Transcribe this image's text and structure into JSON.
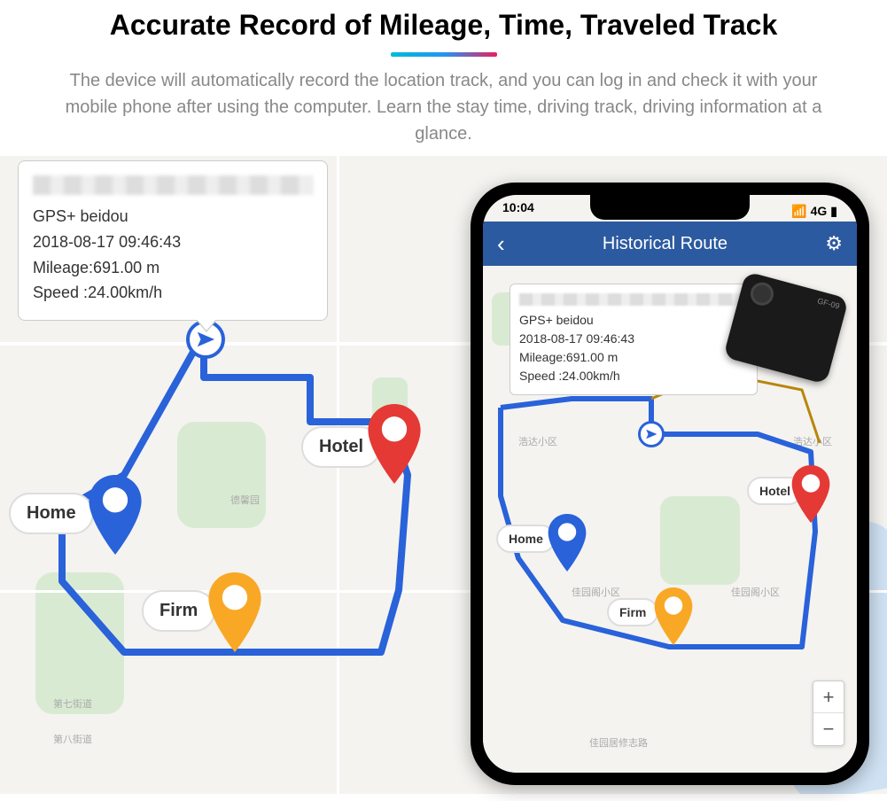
{
  "header": {
    "title": "Accurate Record of Mileage, Time, Traveled Track",
    "description": "The device will automatically record the location track, and you can log in and check it with your mobile phone after using the computer. Learn the stay time, driving track, driving information at a glance."
  },
  "info_card": {
    "line1_label": "GPS+",
    "line1_value": "beidou",
    "line2": "2018-08-17 09:46:43",
    "line3_label": "Mileage:",
    "line3_value": "691.00 m",
    "line4_label": "Speed :",
    "line4_value": "24.00km/h"
  },
  "pins": {
    "hotel": "Hotel",
    "home": "Home",
    "firm": "Firm"
  },
  "phone": {
    "status_time": "10:04",
    "status_right": "4G",
    "nav_title": "Historical Route",
    "device_label": "GF-09",
    "zoom_in": "+",
    "zoom_out": "−"
  },
  "phone_card": {
    "line1_label": "GPS+",
    "line1_value": "beidou",
    "line2": "2018-08-17 09:46:43",
    "line3_label": "Mileage:",
    "line3_value": "691.00 m",
    "line4_label": "Speed :",
    "line4_value": "24.00km/h"
  },
  "colors": {
    "route": "#2962d9",
    "pin_hotel": "#e53935",
    "pin_home": "#2962d9",
    "pin_firm": "#f9a825"
  }
}
